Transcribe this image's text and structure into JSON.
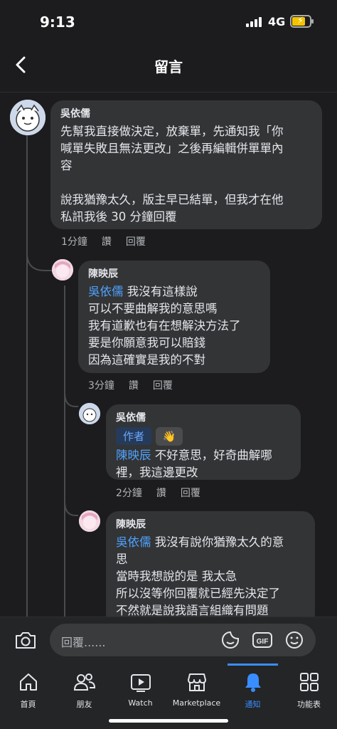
{
  "status_bar": {
    "time": "9:13",
    "network": "4G"
  },
  "header": {
    "title": "留言"
  },
  "comments": [
    {
      "name": "吳依儒",
      "text": "先幫我直接做決定，放棄單，先通知我「你\n喊單失敗且無法更改」之後再編輯併單單內\n容\n\n說我猶豫太久，版主早已結單，但我才在他\n私訊我後 30 分鐘回覆",
      "time": "1分鐘",
      "like": "讚",
      "reply": "回覆"
    },
    {
      "name": "陳映辰",
      "mention": "吳依儒",
      "text": " 我沒有這樣說\n可以不要曲解我的意思嗎\n我有道歉也有在想解決方法了\n要是你願意我可以賠錢\n因為這確實是我的不對",
      "time": "3分鐘",
      "like": "讚",
      "reply": "回覆"
    },
    {
      "name": "吳依儒",
      "badge": "作者",
      "mention": "陳映辰",
      "text": " 不好意思，好奇曲解哪\n裡，我這邊更改",
      "time": "2分鐘",
      "like": "讚",
      "reply": "回覆"
    },
    {
      "name": "陳映辰",
      "mention": "吳依儒",
      "text": " 我沒有說你猶豫太久的意\n思\n當時我想說的是 我太急\n所以沒等你回覆就已經先決定了\n不然就是說我語言組織有問題"
    }
  ],
  "composer": {
    "placeholder": "回覆......"
  },
  "tabs": [
    {
      "label": "首頁",
      "icon": "home-icon"
    },
    {
      "label": "朋友",
      "icon": "friends-icon"
    },
    {
      "label": "Watch",
      "icon": "watch-icon"
    },
    {
      "label": "Marketplace",
      "icon": "marketplace-icon"
    },
    {
      "label": "通知",
      "icon": "bell-icon",
      "active": true
    },
    {
      "label": "功能表",
      "icon": "menu-grid-icon"
    }
  ],
  "colors": {
    "accent": "#3a8dff",
    "mention": "#4fa3ff",
    "bubble": "#333436",
    "background": "#1c1c1e"
  }
}
